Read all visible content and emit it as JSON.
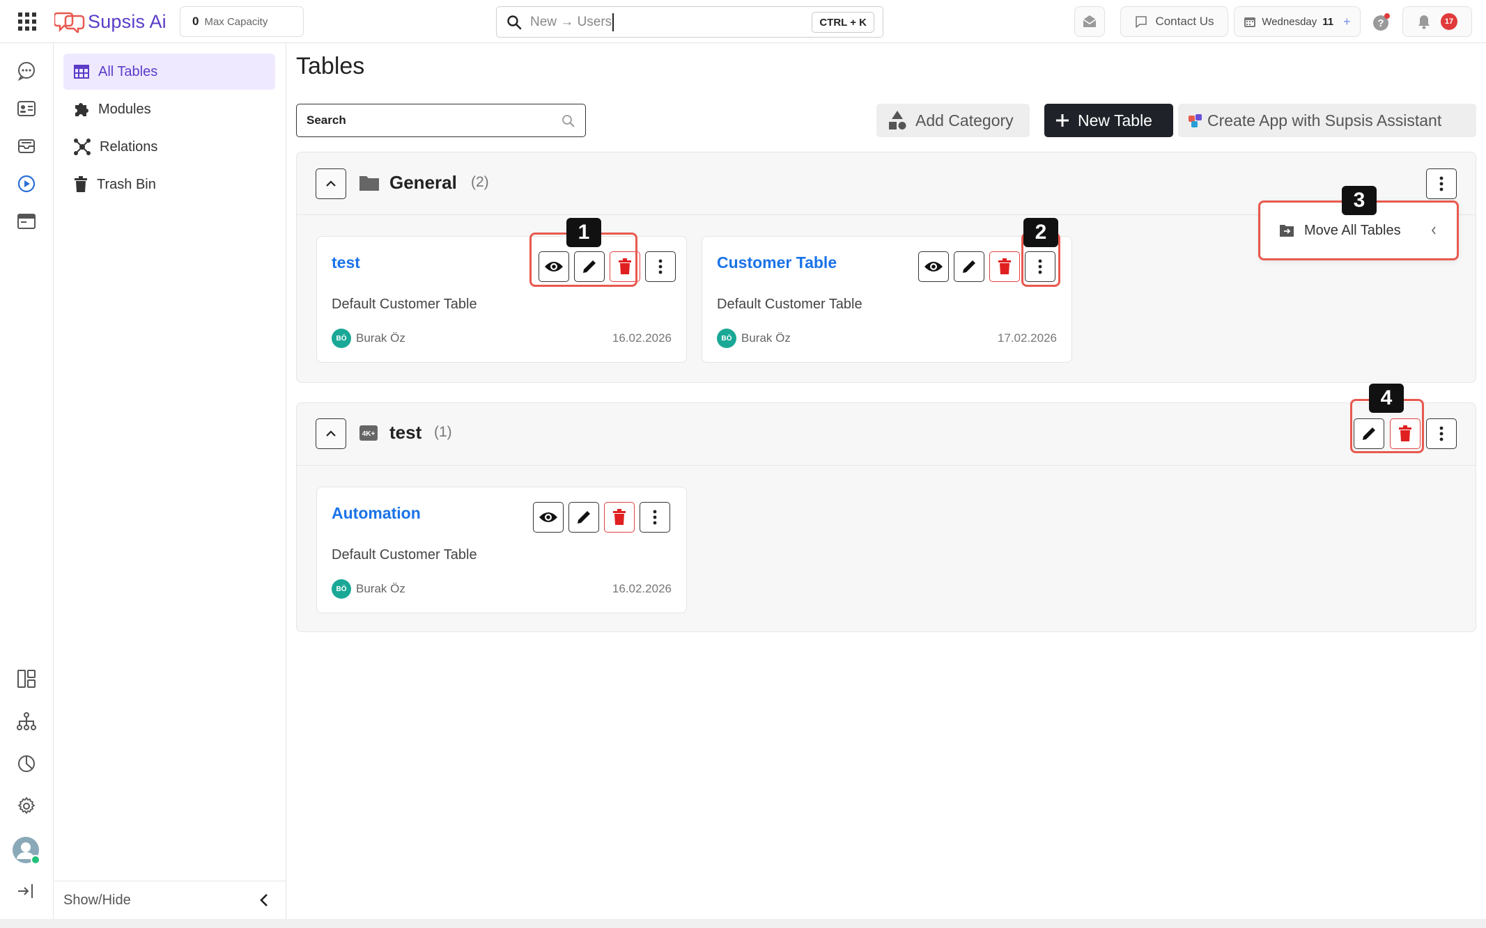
{
  "app": {
    "logo_text": "Supsis Ai",
    "capacity_value": "0",
    "capacity_label": "Max Capacity",
    "search_placeholder": "New → Users",
    "search_shortcut": "CTRL + K",
    "contact_label": "Contact Us",
    "date_label": "Wednesday",
    "date_day": "11",
    "notification_count": "17"
  },
  "sidebar": {
    "items": [
      {
        "label": "All Tables",
        "icon": "table-icon",
        "active": true
      },
      {
        "label": "Modules",
        "icon": "puzzle-icon"
      },
      {
        "label": "Relations",
        "icon": "relations-icon"
      },
      {
        "label": "Trash Bin",
        "icon": "trash-icon"
      }
    ],
    "footer_label": "Show/Hide"
  },
  "main": {
    "title": "Tables",
    "search_placeholder": "Search",
    "add_category_label": "Add Category",
    "new_table_label": "New Table",
    "assistant_label": "Create App with Supsis Assistant"
  },
  "categories": [
    {
      "name": "General",
      "count": "(2)",
      "tables": [
        {
          "title": "test",
          "description": "Default Customer Table",
          "owner_initials": "BÖ",
          "owner": "Burak Öz",
          "date": "16.02.2026"
        },
        {
          "title": "Customer Table",
          "description": "Default Customer Table",
          "owner_initials": "BÖ",
          "owner": "Burak Öz",
          "date": "17.02.2026"
        }
      ],
      "menu_item": "Move All Tables"
    },
    {
      "name": "test",
      "count": "(1)",
      "tables": [
        {
          "title": "Automation",
          "description": "Default Customer Table",
          "owner_initials": "BÖ",
          "owner": "Burak Öz",
          "date": "16.02.2026"
        }
      ]
    }
  ],
  "callouts": [
    "1",
    "2",
    "3",
    "4"
  ],
  "colors": {
    "accent": "#5a3cc8",
    "link": "#1a73e8",
    "danger": "#e04040",
    "callout": "#e8594f",
    "dark": "#222222"
  }
}
